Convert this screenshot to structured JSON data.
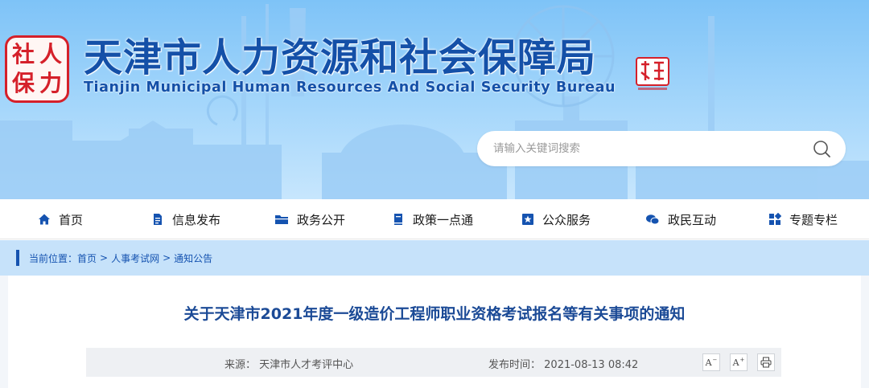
{
  "header": {
    "logo_chars": [
      "社",
      "人",
      "保",
      "力"
    ],
    "title": "天津市人力资源和社会保障局",
    "subtitle": "Tianjin Municipal Human Resources And Social Security Bureau",
    "search": {
      "placeholder": "请输入关键词搜索",
      "icon": "search-icon"
    }
  },
  "nav": {
    "items": [
      {
        "label": "首页",
        "icon": "home-icon"
      },
      {
        "label": "信息发布",
        "icon": "document-icon"
      },
      {
        "label": "政务公开",
        "icon": "folder-icon"
      },
      {
        "label": "政策一点通",
        "icon": "book-icon"
      },
      {
        "label": "公众服务",
        "icon": "star-badge-icon"
      },
      {
        "label": "政民互动",
        "icon": "chat-icon"
      },
      {
        "label": "专题专栏",
        "icon": "grid-icon"
      }
    ]
  },
  "breadcrumb": {
    "prefix": "当前位置：",
    "items": [
      "首页",
      "人事考试网",
      "通知公告"
    ],
    "separator": ">"
  },
  "article": {
    "title": "关于天津市2021年度一级造价工程师职业资格考试报名等有关事项的通知",
    "source_label": "来源：",
    "source": "天津市人才考评中心",
    "date_label": "发布时间：",
    "date": "2021-08-13 08:42",
    "tools": {
      "font_decrease": "A",
      "font_increase": "A",
      "print_icon": "print-icon"
    }
  },
  "colors": {
    "brand_blue": "#1450a8",
    "banner_top": "#7ec3f7",
    "crumb_band": "#c6e2fa",
    "seal_red": "#d5202a"
  }
}
